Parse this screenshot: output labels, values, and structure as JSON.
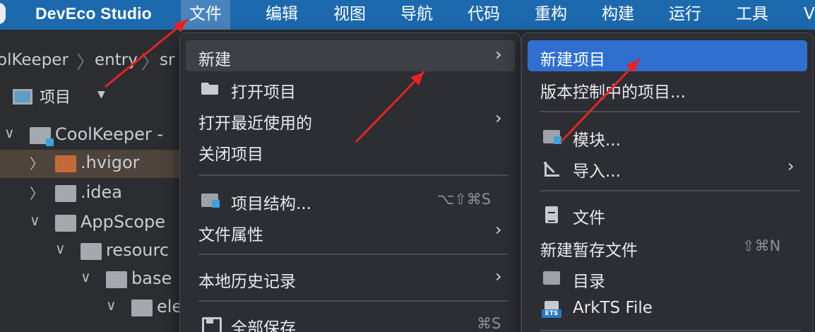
{
  "menubar": {
    "app_name": "DevEco Studio",
    "items": [
      "文件",
      "编辑",
      "视图",
      "导航",
      "代码",
      "重构",
      "构建",
      "运行",
      "工具",
      "V"
    ],
    "active_index": 0
  },
  "breadcrumb": [
    "olKeeper",
    "entry",
    "sr"
  ],
  "project_panel": {
    "title": "项目"
  },
  "tree": [
    {
      "name": "CoolKeeper -"
    },
    {
      "name": ".hvigor"
    },
    {
      "name": ".idea"
    },
    {
      "name": "AppScope"
    },
    {
      "name": "resourc"
    },
    {
      "name": "base"
    },
    {
      "name": "ele"
    }
  ],
  "file_menu": {
    "items": [
      {
        "label": "新建",
        "submenu": true,
        "icon": ""
      },
      {
        "label": "打开项目",
        "icon": "folder-open-icon"
      },
      {
        "label": "打开最近使用的",
        "submenu": true
      },
      {
        "label": "关闭项目"
      },
      {
        "label": "项目结构...",
        "icon": "project-structure-icon",
        "shortcut": "⌥⇧⌘S"
      },
      {
        "label": "文件属性",
        "submenu": true
      },
      {
        "label": "本地历史记录",
        "submenu": true
      },
      {
        "label": "全部保存",
        "icon": "save-icon",
        "shortcut": "⌘S"
      }
    ],
    "hover_index": 0
  },
  "new_submenu": {
    "items": [
      {
        "label": "新建项目"
      },
      {
        "label": "版本控制中的项目..."
      },
      {
        "label": "模块...",
        "icon": "module-folder-icon"
      },
      {
        "label": "导入...",
        "icon": "import-icon",
        "submenu": true
      },
      {
        "label": "文件",
        "icon": "file-icon"
      },
      {
        "label": "新建暂存文件",
        "shortcut": "⇧⌘N"
      },
      {
        "label": "目录",
        "icon": "folder-icon"
      },
      {
        "label": "ArkTS File",
        "icon": "ets-file-icon",
        "icon_text": "ETS"
      }
    ],
    "selected_index": 0
  },
  "colors": {
    "menubar": "#1d69ae",
    "selection": "#2f6fd0",
    "annotation": "#e8231f"
  }
}
